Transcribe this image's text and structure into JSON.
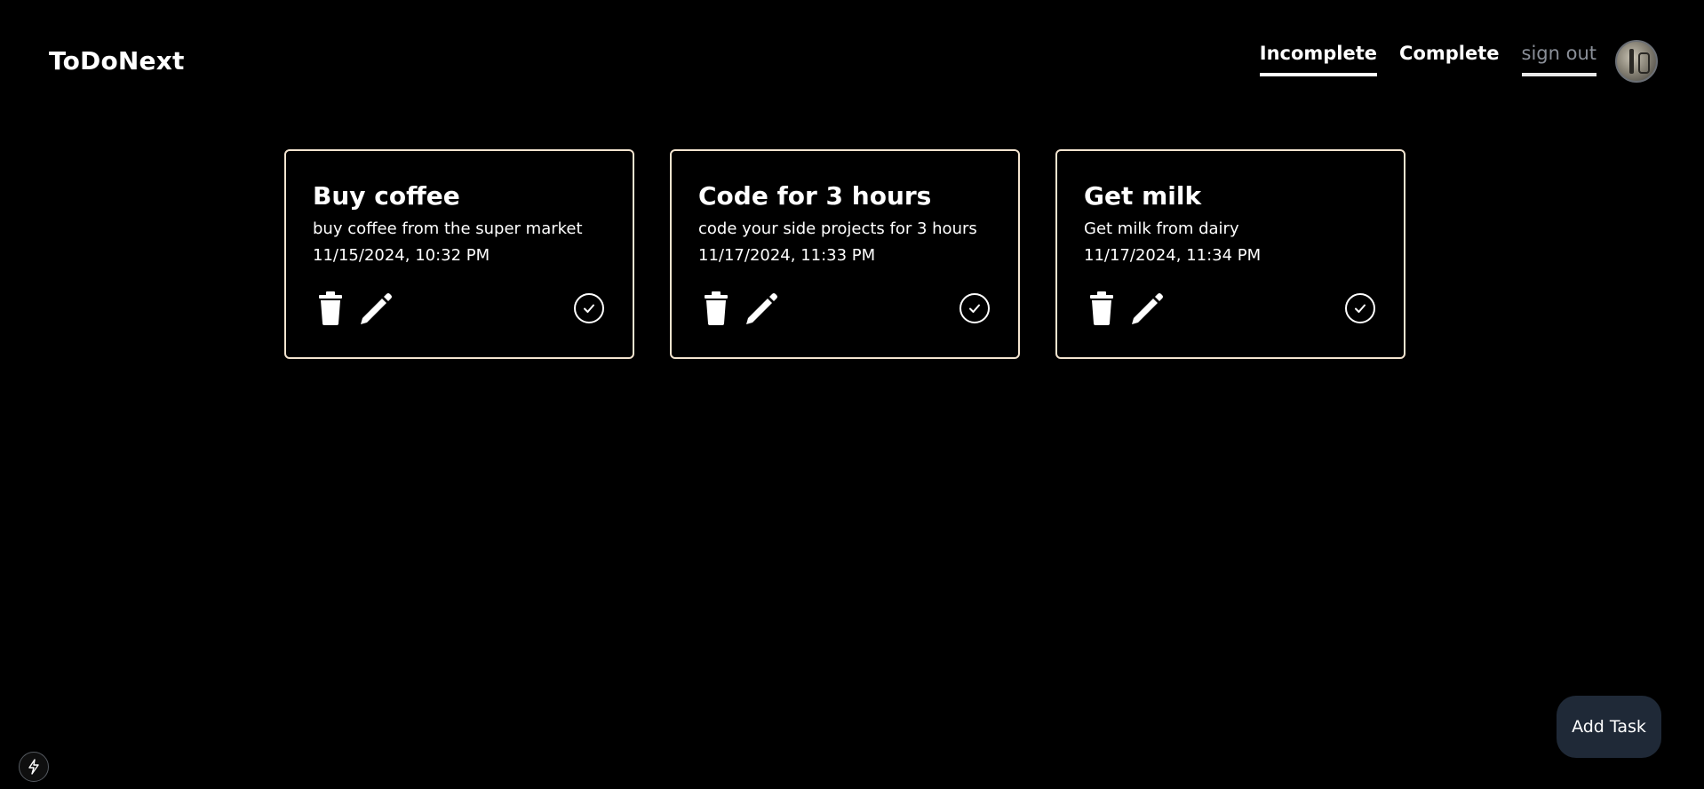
{
  "app": {
    "title": "ToDoNext"
  },
  "nav": {
    "items": [
      {
        "label": "Incomplete",
        "active": true
      },
      {
        "label": "Complete",
        "active": false
      },
      {
        "label": "sign out",
        "active": false
      }
    ]
  },
  "user": {
    "avatar_icon": "user-avatar"
  },
  "tasks": [
    {
      "title": "Buy coffee",
      "description": "buy coffee from the super market",
      "date": "11/15/2024, 10:32 PM"
    },
    {
      "title": "Code for 3 hours",
      "description": "code your side projects for 3 hours",
      "date": "11/17/2024, 11:33 PM"
    },
    {
      "title": "Get milk",
      "description": "Get milk from dairy",
      "date": "11/17/2024, 11:34 PM"
    }
  ],
  "actions": {
    "add_task_label": "Add Task",
    "icons": [
      "trash-icon",
      "pencil-icon",
      "check-circle-icon",
      "lightning-bolt-icon"
    ]
  },
  "colors": {
    "background": "#000000",
    "card_border": "#f3e4cf",
    "add_button_bg": "#1f2937",
    "sign_out_text": "#8a8f98"
  }
}
